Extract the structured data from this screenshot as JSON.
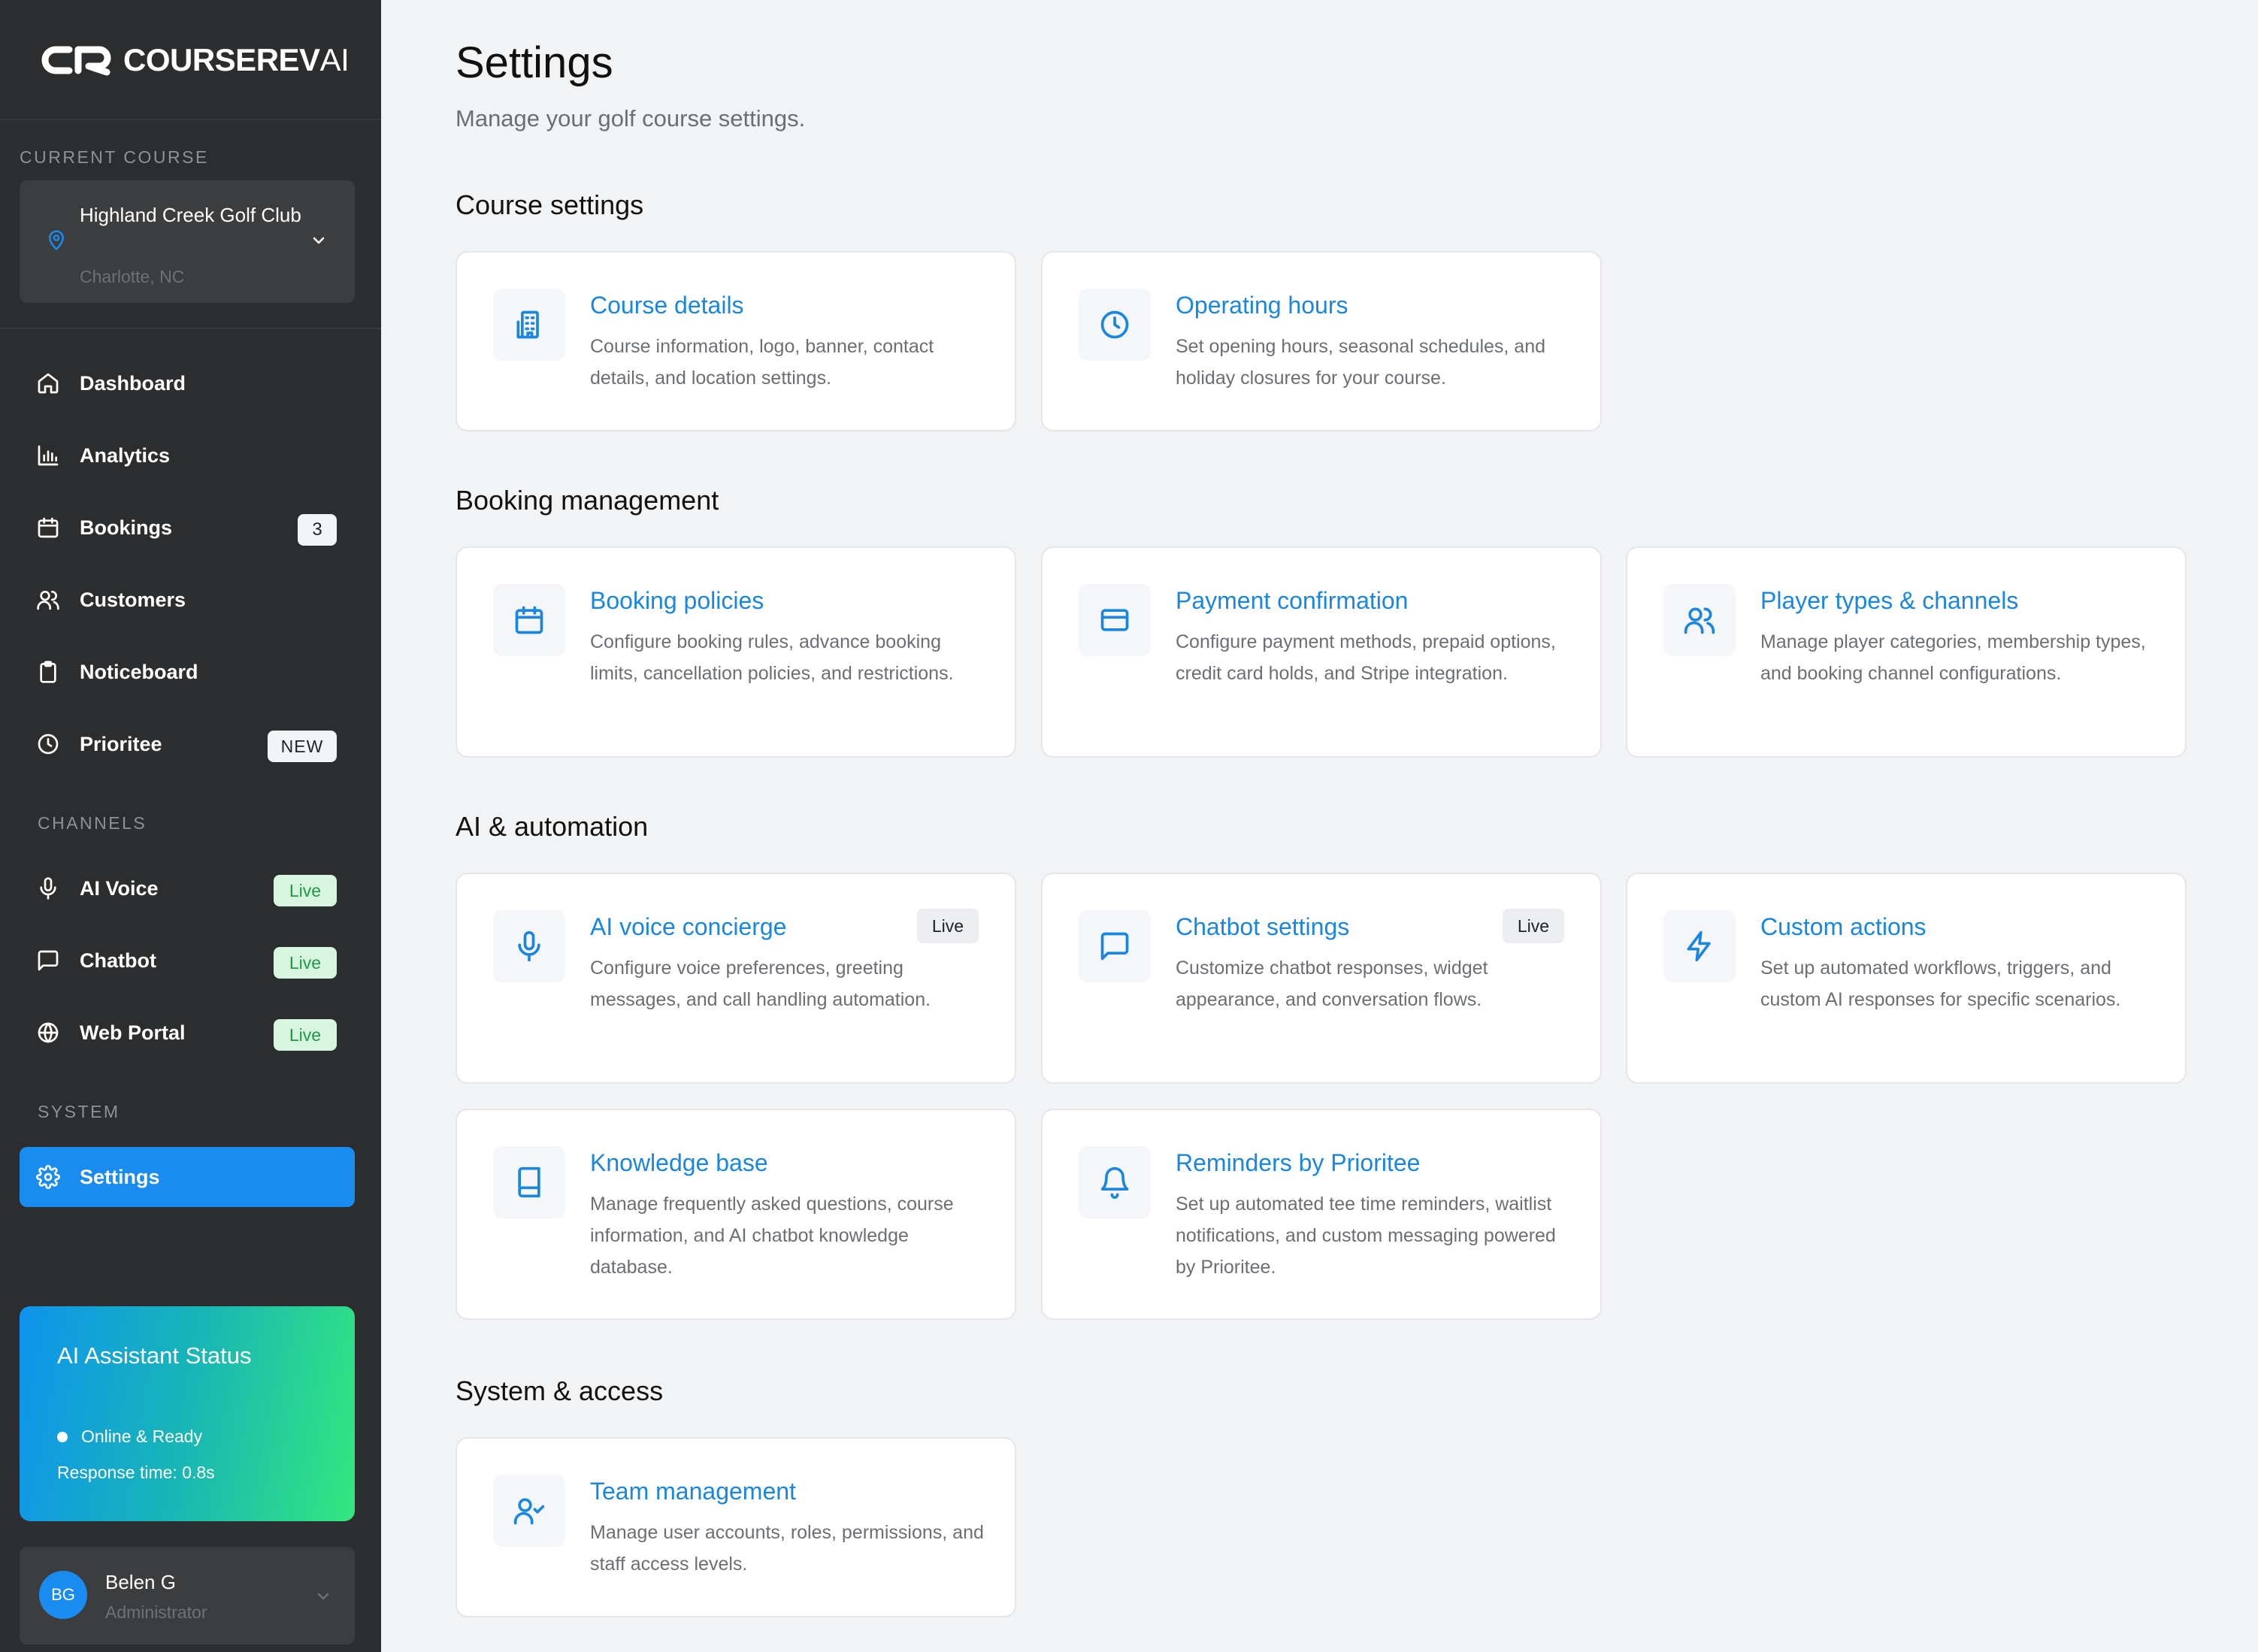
{
  "brand": {
    "name_bold": "COURSEREV",
    "name_light": "AI"
  },
  "current_course": {
    "section_label": "CURRENT COURSE",
    "name": "Highland Creek Golf Club",
    "location": "Charlotte, NC"
  },
  "nav": {
    "dashboard": "Dashboard",
    "analytics": "Analytics",
    "bookings": "Bookings",
    "bookings_count": "3",
    "customers": "Customers",
    "noticeboard": "Noticeboard",
    "prioritee": "Prioritee",
    "prioritee_badge": "NEW",
    "channels_label": "CHANNELS",
    "ai_voice": "AI Voice",
    "chatbot": "Chatbot",
    "web_portal": "Web Portal",
    "live_badge": "Live",
    "system_label": "SYSTEM",
    "settings": "Settings"
  },
  "ai_status": {
    "title": "AI Assistant Status",
    "status": "Online & Ready",
    "response": "Response time: 0.8s"
  },
  "user": {
    "initials": "BG",
    "name": "Belen G",
    "role": "Administrator"
  },
  "page": {
    "title": "Settings",
    "subtitle": "Manage your golf course settings."
  },
  "groups": {
    "course": "Course settings",
    "booking": "Booking management",
    "ai": "AI & automation",
    "system": "System & access"
  },
  "cards": {
    "course_details": {
      "title": "Course details",
      "desc": "Course information, logo, banner, contact details, and location settings."
    },
    "operating_hours": {
      "title": "Operating hours",
      "desc": "Set opening hours, seasonal schedules, and holiday closures for your course."
    },
    "booking_policies": {
      "title": "Booking policies",
      "desc": "Configure booking rules, advance booking limits, cancellation policies, and restrictions."
    },
    "payment_confirmation": {
      "title": "Payment confirmation",
      "desc": "Configure payment methods, prepaid options, credit card holds, and Stripe integration."
    },
    "player_types": {
      "title": "Player types & channels",
      "desc": "Manage player categories, membership types, and booking channel configurations."
    },
    "ai_voice": {
      "title": "AI voice concierge",
      "desc": "Configure voice preferences, greeting messages, and call handling automation.",
      "badge": "Live"
    },
    "chatbot": {
      "title": "Chatbot settings",
      "desc": "Customize chatbot responses, widget appearance, and conversation flows.",
      "badge": "Live"
    },
    "custom_actions": {
      "title": "Custom actions",
      "desc": "Set up automated workflows, triggers, and custom AI responses for specific scenarios."
    },
    "knowledge_base": {
      "title": "Knowledge base",
      "desc": "Manage frequently asked questions, course information, and AI chatbot knowledge database."
    },
    "reminders": {
      "title": "Reminders by Prioritee",
      "desc": "Set up automated tee time reminders, waitlist notifications, and custom messaging powered by Prioritee."
    },
    "team": {
      "title": "Team management",
      "desc": "Manage user accounts, roles, permissions, and staff access levels."
    }
  },
  "colors": {
    "accent": "#1a8cf0",
    "sidebar": "#2c2d2e",
    "live_bg": "#d8f5df",
    "live_text": "#1f9a44"
  }
}
